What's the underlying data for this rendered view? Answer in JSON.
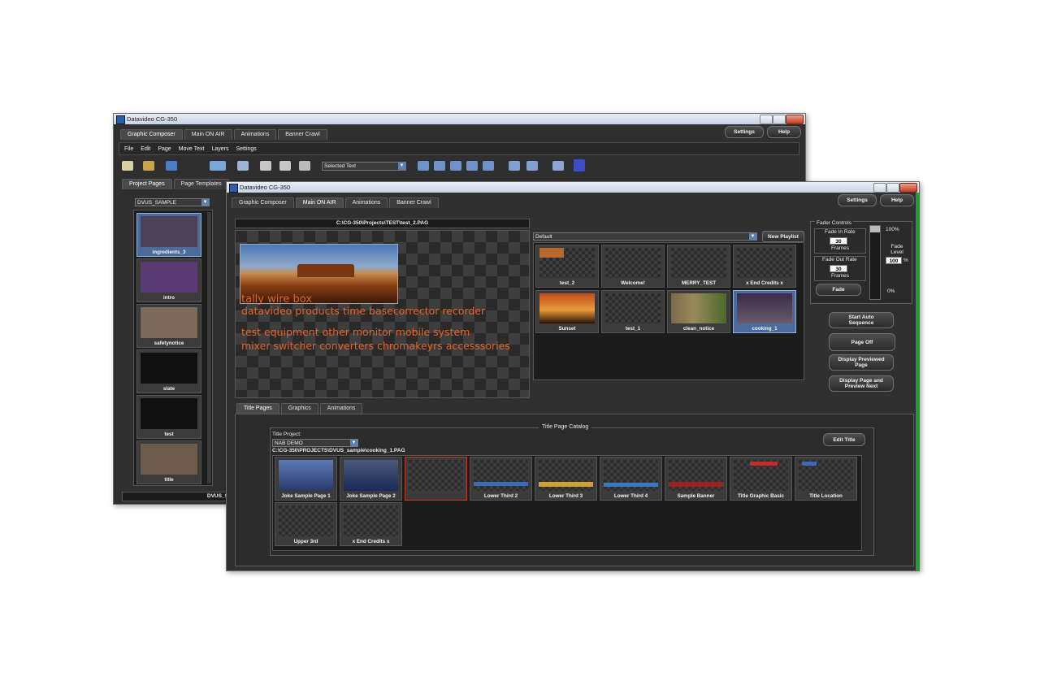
{
  "back_window": {
    "title": "Datavideo CG-350",
    "tabs": [
      "Graphic Composer",
      "Main ON AIR",
      "Animations",
      "Banner Crawl"
    ],
    "settings_label": "Settings",
    "help_label": "Help",
    "menu": [
      "File",
      "Edit",
      "Page",
      "Move Text",
      "Layers",
      "Settings"
    ],
    "selected_text_dropdown": "Selected Text",
    "side_tabs": [
      "Project Pages",
      "Page Templates"
    ],
    "project_dropdown": "DVUS_SAMPLE",
    "pages": [
      "ingredients_3",
      "intro",
      "safetynotice",
      "slate",
      "test",
      "title"
    ],
    "status_text": "DVUS_SAM"
  },
  "front_window": {
    "title": "Datavideo CG-350",
    "tabs": [
      "Graphic Composer",
      "Main ON AIR",
      "Animations",
      "Banner Crawl"
    ],
    "active_tab": "Main ON AIR",
    "settings_label": "Settings",
    "help_label": "Help",
    "preview_path": "C:\\CG-350\\Projects\\TEST\\test_2.PAG",
    "preview_lines": [
      "tally wire box",
      "datavideo products time basecorrector recorder",
      "test equipment other monitor mobile system",
      "mixer switcher converters chromakeyrs accesssories"
    ],
    "playlist_dropdown": "Default",
    "new_playlist_label": "New Playlist",
    "playlist_items": [
      "test_2",
      "Welcome!",
      "MERRY_TEST",
      "x End Credits x",
      "Sunset",
      "test_1",
      "clean_notice",
      "cooking_1"
    ],
    "fader": {
      "title": "Fader Controls",
      "fade_in_label": "Fade In Rate",
      "fade_in_value": "30",
      "fade_out_label": "Fade Out Rate",
      "fade_out_value": "30",
      "frames_label": "Frames",
      "fade_button": "Fade",
      "top_pct": "100%",
      "level_label": "Fade Level",
      "level_value": "100",
      "pct_sign": "%",
      "bottom_pct": "0%"
    },
    "actions": [
      "Start Auto Sequence",
      "Page Off",
      "Display Previewed Page",
      "Display Page and Preview Next"
    ],
    "bottom_tabs": [
      "Title Pages",
      "Graphics",
      "Animations"
    ],
    "catalog": {
      "title": "Title Page Catalog",
      "project_label": "Title Project:",
      "project_value": "NAB DEMO",
      "edit_title": "Edit Title",
      "path": "C:\\CG-350\\PROJECTS\\DVUS_sample\\cooking_1.PAG",
      "items": [
        "Joke Sample Page 1",
        "Joke Sample Page 2",
        "",
        "Lower Third 2",
        "Lower Third 3",
        "Lower Third 4",
        "Sample Banner",
        "Title Graphic Basic",
        "Title Location",
        "Upper 3rd",
        "x End Credits x"
      ]
    }
  },
  "colors": {
    "window_bg": "#2f2f2f",
    "preview_text": "#e0642a",
    "selection": "#4b6b9a",
    "accent_green": "#1fa032"
  }
}
